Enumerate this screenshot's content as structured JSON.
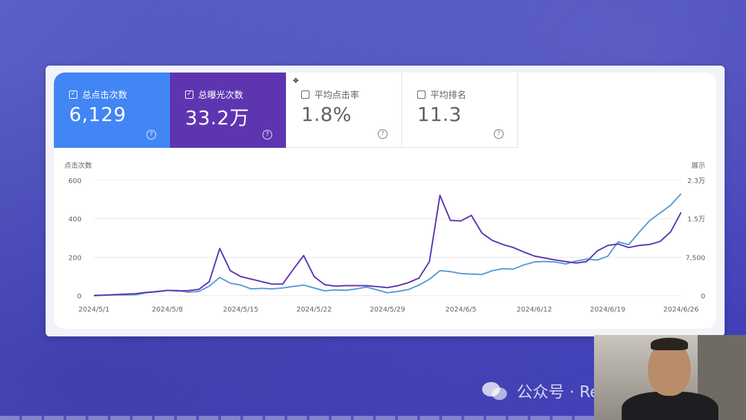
{
  "metrics": [
    {
      "label": "总点击次数",
      "value": "6,129",
      "checked": true,
      "color": "#4285f4"
    },
    {
      "label": "总曝光次数",
      "value": "33.2万",
      "checked": true,
      "color": "#5e35b1"
    },
    {
      "label": "平均点击率",
      "value": "1.8%",
      "checked": false
    },
    {
      "label": "平均排名",
      "value": "11.3",
      "checked": false
    }
  ],
  "help_glyph": "?",
  "chart_data": {
    "type": "line",
    "left_axis_label": "点击次数",
    "right_axis_label": "展示",
    "left_ticks": [
      "600",
      "400",
      "200",
      "0"
    ],
    "right_ticks": [
      "2.3万",
      "1.5万",
      "7,500",
      "0"
    ],
    "ylim_left": [
      0,
      600
    ],
    "ylim_right": [
      0,
      23000
    ],
    "x_ticks": [
      "2024/5/1",
      "2024/5/8",
      "2024/5/15",
      "2024/5/22",
      "2024/5/29",
      "2024/6/5",
      "2024/6/12",
      "2024/6/19",
      "2024/6/26"
    ],
    "series": [
      {
        "name": "点击次数",
        "axis": "left",
        "color": "#5b9bd5",
        "values": [
          2,
          3,
          4,
          4,
          5,
          15,
          22,
          27,
          27,
          18,
          22,
          50,
          95,
          65,
          55,
          35,
          38,
          35,
          40,
          48,
          55,
          40,
          25,
          30,
          28,
          35,
          45,
          30,
          15,
          22,
          32,
          55,
          85,
          130,
          125,
          115,
          112,
          110,
          130,
          140,
          138,
          160,
          175,
          178,
          175,
          165,
          180,
          190,
          185,
          205,
          280,
          265,
          330,
          390,
          430,
          470,
          530
        ]
      },
      {
        "name": "展示",
        "axis": "right",
        "color": "#5e35b1",
        "values": [
          0,
          100,
          200,
          300,
          400,
          650,
          800,
          1050,
          950,
          1000,
          1250,
          2800,
          9400,
          5000,
          3800,
          3300,
          2800,
          2300,
          2300,
          5200,
          8000,
          3800,
          2200,
          1900,
          2000,
          2000,
          2000,
          1800,
          1600,
          2000,
          2600,
          3500,
          6800,
          20000,
          15000,
          14900,
          16000,
          12500,
          11000,
          10200,
          9600,
          8700,
          7900,
          7500,
          7100,
          6800,
          6500,
          6800,
          8900,
          10000,
          10300,
          9600,
          10000,
          10200,
          10800,
          12700,
          16600
        ]
      }
    ]
  },
  "watermark": {
    "text": "公众号 · ReadLecture"
  }
}
